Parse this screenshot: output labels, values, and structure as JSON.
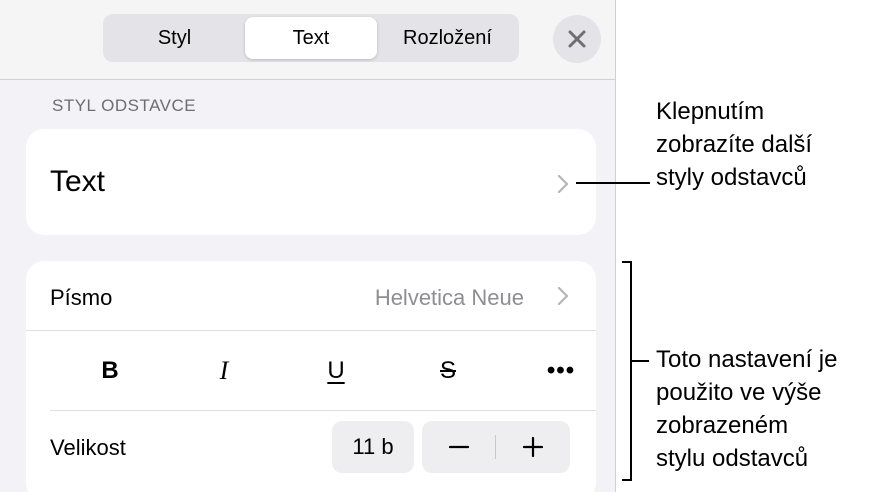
{
  "tabs": [
    {
      "label": "Styl",
      "selected": false
    },
    {
      "label": "Text",
      "selected": true
    },
    {
      "label": "Rozložení",
      "selected": false
    }
  ],
  "paragraph_style": {
    "section_label": "STYL ODSTAVCE",
    "value": "Text"
  },
  "font": {
    "label": "Písmo",
    "value": "Helvetica Neue"
  },
  "format_buttons": {
    "bold": "B",
    "italic": "I",
    "underline": "U",
    "strikethrough": "S",
    "more": "•••"
  },
  "size": {
    "label": "Velikost",
    "value": "11 b"
  },
  "annotations": {
    "top": [
      "Klepnutím",
      "zobrazíte další",
      "styly odstavců"
    ],
    "bottom": [
      "Toto nastavení je",
      "použito ve výše",
      "zobrazeném",
      "stylu odstavců"
    ]
  },
  "colors": {
    "panel_bg": "#f2f2f7",
    "secondary_text": "#8e8e93",
    "section_label": "#6d6d72"
  },
  "icons": {
    "close": "close-icon",
    "chevron": "chevron-right-icon",
    "minus": "minus-icon",
    "plus": "plus-icon"
  }
}
